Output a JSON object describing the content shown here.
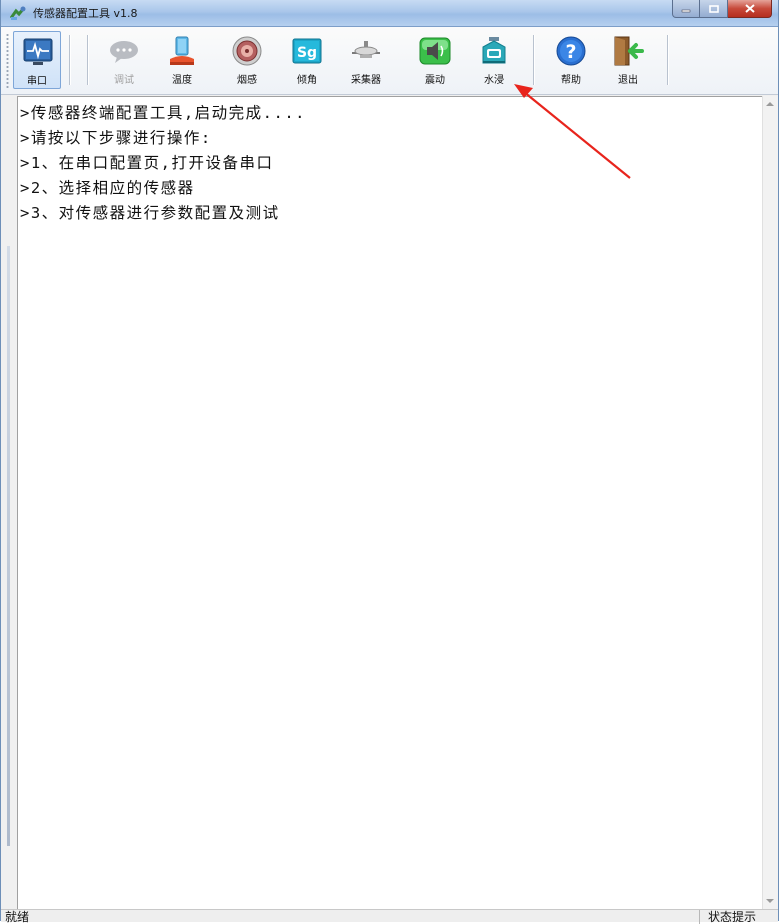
{
  "window": {
    "title": "传感器配置工具 v1.8"
  },
  "toolbar": {
    "buttons": [
      {
        "id": "serial",
        "label": "串口",
        "icon": "serial-port-icon",
        "active": true,
        "enabled": true
      },
      {
        "id": "debug",
        "label": "调试",
        "icon": "chat-bubble-icon",
        "active": false,
        "enabled": false
      },
      {
        "id": "temperature",
        "label": "温度",
        "icon": "temperature-sensor-icon",
        "active": false,
        "enabled": true
      },
      {
        "id": "smoke",
        "label": "烟感",
        "icon": "smoke-detector-icon",
        "active": false,
        "enabled": true
      },
      {
        "id": "tilt",
        "label": "倾角",
        "icon": "tilt-sg-icon",
        "active": false,
        "enabled": true
      },
      {
        "id": "collector",
        "label": "采集器",
        "icon": "collector-icon",
        "active": false,
        "enabled": true
      },
      {
        "id": "vibration",
        "label": "震动",
        "icon": "speaker-vibration-icon",
        "active": false,
        "enabled": true
      },
      {
        "id": "water",
        "label": "水浸",
        "icon": "water-sensor-icon",
        "active": false,
        "enabled": true
      },
      {
        "id": "help",
        "label": "帮助",
        "icon": "help-question-icon",
        "active": false,
        "enabled": true
      },
      {
        "id": "exit",
        "label": "退出",
        "icon": "exit-door-icon",
        "active": false,
        "enabled": true
      }
    ]
  },
  "log": {
    "lines": [
      ">传感器终端配置工具,启动完成....",
      ">请按以下步骤进行操作:",
      ">1、在串口配置页,打开设备串口",
      ">2、选择相应的传感器",
      ">3、对传感器进行参数配置及测试"
    ]
  },
  "statusbar": {
    "left": "就绪",
    "right": "状态提示"
  },
  "colors": {
    "annotation_arrow": "#e8241c",
    "titlebar": "#a9c6ea",
    "close_button": "#c7493a"
  }
}
